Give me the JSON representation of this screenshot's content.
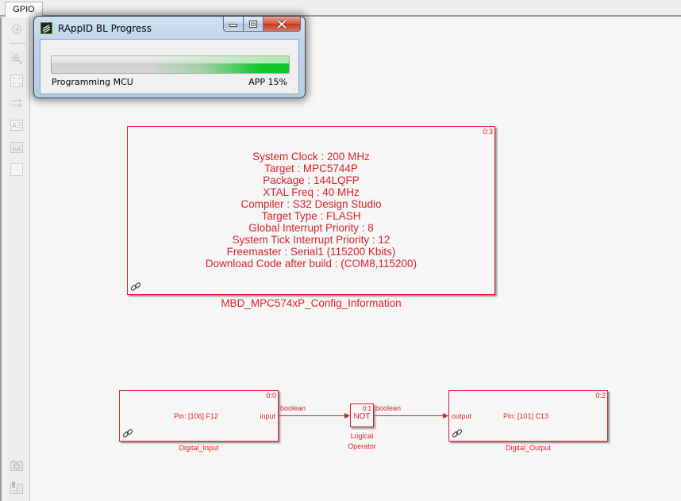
{
  "tab": {
    "label": "GPIO"
  },
  "toolbar": {
    "items": [
      {
        "icon": "navigate-back-icon"
      },
      {
        "icon": "zoom-in-icon"
      },
      {
        "icon": "fit-to-view-icon"
      },
      {
        "icon": "arrows-right-icon"
      },
      {
        "icon": "annotation-icon"
      },
      {
        "icon": "image-icon"
      },
      {
        "icon": "area-icon"
      },
      {
        "icon": "camera-icon"
      },
      {
        "icon": "property-inspector-icon"
      }
    ]
  },
  "dialog": {
    "title": "RAppID BL Progress",
    "status": "Programming MCU",
    "progress_label": "APP 15%",
    "progress_percent": 15,
    "progress_color": "#10c62a",
    "buttons": {
      "minimize": "minimize",
      "maximize": "maximize",
      "close": "close"
    }
  },
  "diagram": {
    "accent_color": "#d8232a",
    "config_block": {
      "id": "0:3",
      "name": "MBD_MPC574xP_Config_Information",
      "lines": [
        "System Clock : 200 MHz",
        "Target : MPC5744P",
        "Package : 144LQFP",
        "XTAL Freq : 40 MHz",
        "Compiler : S32 Design Studio",
        "Target Type : FLASH",
        "Global Interrupt Priority : 8",
        "System Tick Interrupt Priority : 12",
        "Freemaster : Serial1 (115200 Kbits)",
        "Download Code after build : (COM8,115200)"
      ]
    },
    "digital_input": {
      "id": "0:0",
      "name": "Digital_Input",
      "pin_text": "Pin: [106] F12",
      "port": "input"
    },
    "logical_operator": {
      "id": "0:1",
      "name_line1": "Logical",
      "name_line2": "Operator",
      "op": "NOT"
    },
    "digital_output": {
      "id": "0:2",
      "name": "Digital_Output",
      "pin_text": "Pin: [101] C13",
      "port": "output"
    },
    "signals": {
      "sig1": "boolean",
      "sig2": "boolean"
    }
  }
}
